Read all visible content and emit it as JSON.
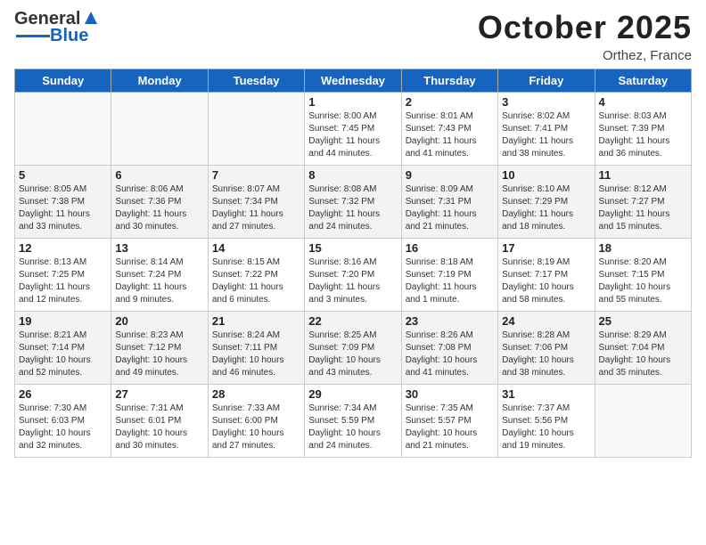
{
  "header": {
    "logo_text_general": "General",
    "logo_text_blue": "Blue",
    "title": "October 2025",
    "location": "Orthez, France"
  },
  "days_of_week": [
    "Sunday",
    "Monday",
    "Tuesday",
    "Wednesday",
    "Thursday",
    "Friday",
    "Saturday"
  ],
  "weeks": [
    [
      {
        "day": "",
        "info": ""
      },
      {
        "day": "",
        "info": ""
      },
      {
        "day": "",
        "info": ""
      },
      {
        "day": "1",
        "info": "Sunrise: 8:00 AM\nSunset: 7:45 PM\nDaylight: 11 hours\nand 44 minutes."
      },
      {
        "day": "2",
        "info": "Sunrise: 8:01 AM\nSunset: 7:43 PM\nDaylight: 11 hours\nand 41 minutes."
      },
      {
        "day": "3",
        "info": "Sunrise: 8:02 AM\nSunset: 7:41 PM\nDaylight: 11 hours\nand 38 minutes."
      },
      {
        "day": "4",
        "info": "Sunrise: 8:03 AM\nSunset: 7:39 PM\nDaylight: 11 hours\nand 36 minutes."
      }
    ],
    [
      {
        "day": "5",
        "info": "Sunrise: 8:05 AM\nSunset: 7:38 PM\nDaylight: 11 hours\nand 33 minutes."
      },
      {
        "day": "6",
        "info": "Sunrise: 8:06 AM\nSunset: 7:36 PM\nDaylight: 11 hours\nand 30 minutes."
      },
      {
        "day": "7",
        "info": "Sunrise: 8:07 AM\nSunset: 7:34 PM\nDaylight: 11 hours\nand 27 minutes."
      },
      {
        "day": "8",
        "info": "Sunrise: 8:08 AM\nSunset: 7:32 PM\nDaylight: 11 hours\nand 24 minutes."
      },
      {
        "day": "9",
        "info": "Sunrise: 8:09 AM\nSunset: 7:31 PM\nDaylight: 11 hours\nand 21 minutes."
      },
      {
        "day": "10",
        "info": "Sunrise: 8:10 AM\nSunset: 7:29 PM\nDaylight: 11 hours\nand 18 minutes."
      },
      {
        "day": "11",
        "info": "Sunrise: 8:12 AM\nSunset: 7:27 PM\nDaylight: 11 hours\nand 15 minutes."
      }
    ],
    [
      {
        "day": "12",
        "info": "Sunrise: 8:13 AM\nSunset: 7:25 PM\nDaylight: 11 hours\nand 12 minutes."
      },
      {
        "day": "13",
        "info": "Sunrise: 8:14 AM\nSunset: 7:24 PM\nDaylight: 11 hours\nand 9 minutes."
      },
      {
        "day": "14",
        "info": "Sunrise: 8:15 AM\nSunset: 7:22 PM\nDaylight: 11 hours\nand 6 minutes."
      },
      {
        "day": "15",
        "info": "Sunrise: 8:16 AM\nSunset: 7:20 PM\nDaylight: 11 hours\nand 3 minutes."
      },
      {
        "day": "16",
        "info": "Sunrise: 8:18 AM\nSunset: 7:19 PM\nDaylight: 11 hours\nand 1 minute."
      },
      {
        "day": "17",
        "info": "Sunrise: 8:19 AM\nSunset: 7:17 PM\nDaylight: 10 hours\nand 58 minutes."
      },
      {
        "day": "18",
        "info": "Sunrise: 8:20 AM\nSunset: 7:15 PM\nDaylight: 10 hours\nand 55 minutes."
      }
    ],
    [
      {
        "day": "19",
        "info": "Sunrise: 8:21 AM\nSunset: 7:14 PM\nDaylight: 10 hours\nand 52 minutes."
      },
      {
        "day": "20",
        "info": "Sunrise: 8:23 AM\nSunset: 7:12 PM\nDaylight: 10 hours\nand 49 minutes."
      },
      {
        "day": "21",
        "info": "Sunrise: 8:24 AM\nSunset: 7:11 PM\nDaylight: 10 hours\nand 46 minutes."
      },
      {
        "day": "22",
        "info": "Sunrise: 8:25 AM\nSunset: 7:09 PM\nDaylight: 10 hours\nand 43 minutes."
      },
      {
        "day": "23",
        "info": "Sunrise: 8:26 AM\nSunset: 7:08 PM\nDaylight: 10 hours\nand 41 minutes."
      },
      {
        "day": "24",
        "info": "Sunrise: 8:28 AM\nSunset: 7:06 PM\nDaylight: 10 hours\nand 38 minutes."
      },
      {
        "day": "25",
        "info": "Sunrise: 8:29 AM\nSunset: 7:04 PM\nDaylight: 10 hours\nand 35 minutes."
      }
    ],
    [
      {
        "day": "26",
        "info": "Sunrise: 7:30 AM\nSunset: 6:03 PM\nDaylight: 10 hours\nand 32 minutes."
      },
      {
        "day": "27",
        "info": "Sunrise: 7:31 AM\nSunset: 6:01 PM\nDaylight: 10 hours\nand 30 minutes."
      },
      {
        "day": "28",
        "info": "Sunrise: 7:33 AM\nSunset: 6:00 PM\nDaylight: 10 hours\nand 27 minutes."
      },
      {
        "day": "29",
        "info": "Sunrise: 7:34 AM\nSunset: 5:59 PM\nDaylight: 10 hours\nand 24 minutes."
      },
      {
        "day": "30",
        "info": "Sunrise: 7:35 AM\nSunset: 5:57 PM\nDaylight: 10 hours\nand 21 minutes."
      },
      {
        "day": "31",
        "info": "Sunrise: 7:37 AM\nSunset: 5:56 PM\nDaylight: 10 hours\nand 19 minutes."
      },
      {
        "day": "",
        "info": ""
      }
    ]
  ]
}
